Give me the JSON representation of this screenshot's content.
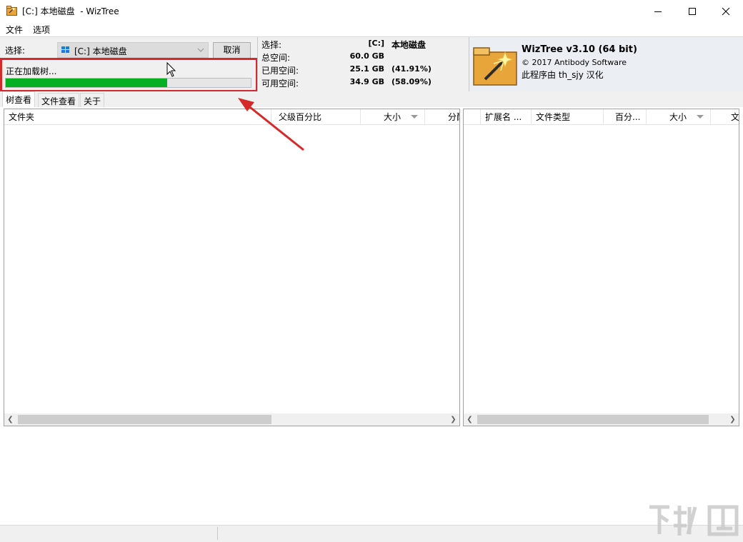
{
  "window": {
    "title": "[C:] 本地磁盘  - WizTree",
    "minimize_icon": "minimize-icon",
    "maximize_icon": "maximize-icon",
    "close_icon": "close-icon"
  },
  "menu": {
    "items": [
      "文件",
      "选项"
    ]
  },
  "toolbar": {
    "select_label": "选择:",
    "drive_value": "[C:] 本地磁盘",
    "cancel_label": "取消",
    "loading_text": "正在加载树...",
    "progress": 0.66
  },
  "drive_info": {
    "select_key": "选择:",
    "select_drive": "[C:]",
    "select_name": "本地磁盘",
    "total_key": "总空间:",
    "total_val": "60.0 GB",
    "used_key": "已用空间:",
    "used_val": "25.1 GB",
    "used_pct": "(41.91%)",
    "free_key": "可用空间:",
    "free_val": "34.9 GB",
    "free_pct": "(58.09%)"
  },
  "about": {
    "title": "WizTree v3.10 (64 bit)",
    "copyright": "© 2017 Antibody Software",
    "credit": "此程序由 th_sjy 汉化"
  },
  "tabs": [
    "树查看",
    "文件查看",
    "关于"
  ],
  "tree_pane": {
    "columns": [
      "文件夹",
      "父级百分比",
      "大小",
      "分配"
    ]
  },
  "ext_pane": {
    "columns": [
      "扩展名 ...",
      "文件类型",
      "百分...",
      "大小",
      "文"
    ]
  },
  "colors": {
    "progress": "#06b025",
    "highlight": "#d42a2a",
    "arrow": "#d42a2a"
  },
  "watermark_text": "下载吧"
}
